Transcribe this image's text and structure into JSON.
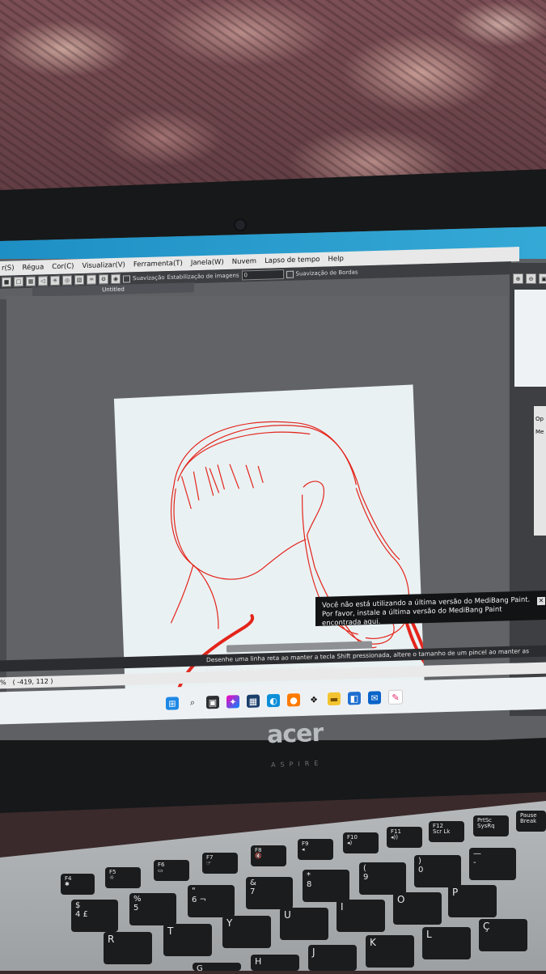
{
  "menu": {
    "items": [
      "r(S)",
      "Régua",
      "Cor(C)",
      "Visualizar(V)",
      "Ferramenta(T)",
      "Janela(W)",
      "Nuvem",
      "Lapso de tempo",
      "Help"
    ]
  },
  "toolbar": {
    "smoothing_label": "Suavização",
    "stabilization_label": "Estabilização de imagens",
    "stabilization_value": "0",
    "edge_smoothing_label": "Suavização de Bordas"
  },
  "document": {
    "tab_title": "Untitled"
  },
  "notice": {
    "line1": "Você não está utilizando a última versão do MediBang Paint.",
    "line2": "Por favor, instale a última versão do MediBang Paint encontrada aqui."
  },
  "hint_text": "Desenhe uma linha reta ao manter a tecla Shift pressionada, altere o tamanho de um pincel ao manter as teclas Ctrl + Alt pressionadas e arrastando",
  "status": {
    "zoom": "%",
    "coords": "( -419, 112 )"
  },
  "right_panel": {
    "label_top": "Op",
    "label_mid": "Me"
  },
  "laptop": {
    "brand": "acer",
    "model": "ASPIRE"
  },
  "keyboard": {
    "keys": [
      {
        "label": "F4\n✱"
      },
      {
        "label": "F5\n☼"
      },
      {
        "label": "F6\n▭"
      },
      {
        "label": "F7\n☞"
      },
      {
        "label": "F8\n🔇"
      },
      {
        "label": "F9\n◂"
      },
      {
        "label": "F10\n◂)"
      },
      {
        "label": "F11\n◂))"
      },
      {
        "label": "F12\nScr Lk"
      },
      {
        "label": "PrtSc\nSysRq"
      },
      {
        "label": "Pause\nBreak"
      },
      {
        "label": "$\n4 £"
      },
      {
        "label": "%\n5"
      },
      {
        "label": "\"\n6 ¬"
      },
      {
        "label": "&\n7"
      },
      {
        "label": "*\n8"
      },
      {
        "label": "(\n9"
      },
      {
        "label": ")\n0"
      },
      {
        "label": "—\n-"
      },
      {
        "label": "R"
      },
      {
        "label": "T"
      },
      {
        "label": "Y"
      },
      {
        "label": "U"
      },
      {
        "label": "I"
      },
      {
        "label": "O"
      },
      {
        "label": "P"
      },
      {
        "label": "G"
      },
      {
        "label": "H"
      },
      {
        "label": "J"
      },
      {
        "label": "K"
      },
      {
        "label": "L"
      },
      {
        "label": "Ç"
      }
    ]
  }
}
